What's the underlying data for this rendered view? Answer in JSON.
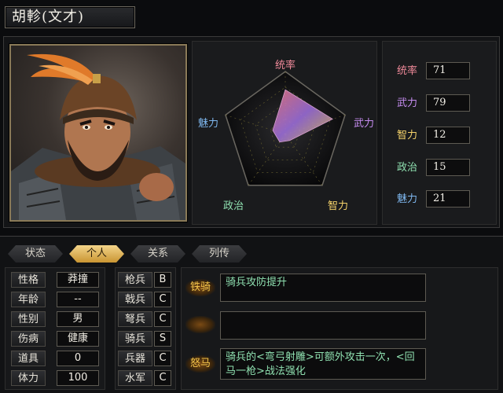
{
  "officer": {
    "name": "胡軫(文才)"
  },
  "radar": {
    "labels": {
      "leadership": "统率",
      "war": "武力",
      "intelligence": "智力",
      "politics": "政治",
      "charisma": "魅力"
    },
    "max": 100,
    "label_colors": {
      "leadership": "#f08a9a",
      "war": "#c58cf0",
      "intelligence": "#f5d26a",
      "politics": "#8fe0b0",
      "charisma": "#7fb8f0"
    }
  },
  "stats": [
    {
      "label": "统率",
      "value": "71",
      "color": "#f08a9a"
    },
    {
      "label": "武力",
      "value": "79",
      "color": "#c58cf0"
    },
    {
      "label": "智力",
      "value": "12",
      "color": "#f5d26a"
    },
    {
      "label": "政治",
      "value": "15",
      "color": "#8fe0b0"
    },
    {
      "label": "魅力",
      "value": "21",
      "color": "#7fb8f0"
    }
  ],
  "tabs": [
    {
      "label": "状态",
      "active": false
    },
    {
      "label": "个人",
      "active": true
    },
    {
      "label": "关系",
      "active": false
    },
    {
      "label": "列传",
      "active": false
    }
  ],
  "personal": [
    {
      "label": "性格",
      "value": "莽撞"
    },
    {
      "label": "年龄",
      "value": "--"
    },
    {
      "label": "性别",
      "value": "男"
    },
    {
      "label": "伤病",
      "value": "健康"
    },
    {
      "label": "道具",
      "value": "0"
    },
    {
      "label": "体力",
      "value": "100"
    }
  ],
  "aptitudes": [
    {
      "label": "枪兵",
      "grade": "B"
    },
    {
      "label": "戟兵",
      "grade": "C"
    },
    {
      "label": "弩兵",
      "grade": "C"
    },
    {
      "label": "骑兵",
      "grade": "S"
    },
    {
      "label": "兵器",
      "grade": "C"
    },
    {
      "label": "水军",
      "grade": "C"
    }
  ],
  "skills": [
    {
      "label": "铁骑",
      "description": "骑兵攻防提升"
    },
    {
      "label": "",
      "description": ""
    },
    {
      "label": "怒马",
      "description": "骑兵的<弯弓射雕>可额外攻击一次，<回马一枪>战法强化"
    }
  ]
}
